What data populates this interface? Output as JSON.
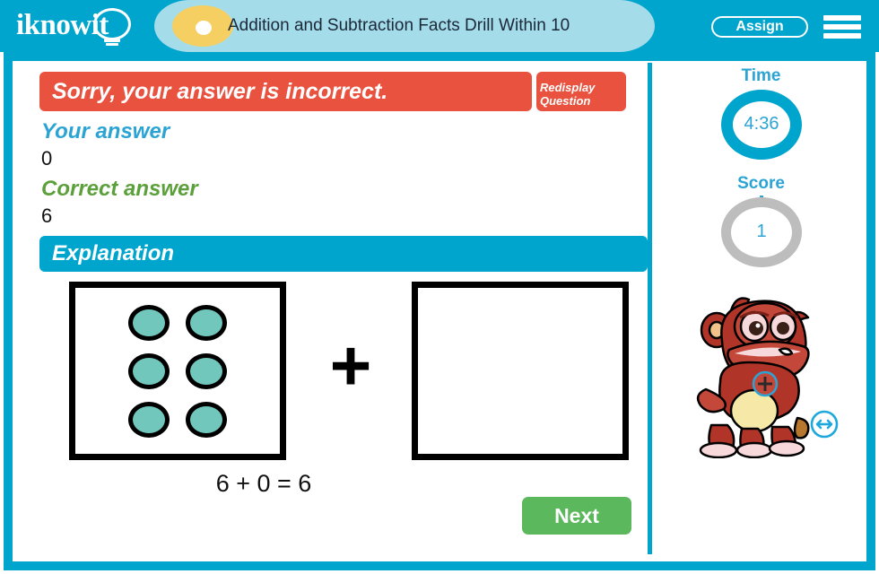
{
  "header": {
    "logo_text": "iknowit",
    "logo_icon": "lightbulb-icon",
    "title": "Addition and Subtraction Facts Drill Within 10",
    "assign_label": "Assign",
    "menu_icon": "hamburger-menu-icon",
    "bar_color": "#00A5CE",
    "title_band_color": "#A5DCEA",
    "title_dot_color": "#F6CF62"
  },
  "feedback": {
    "message": "Sorry, your answer is incorrect.",
    "redisplay_label": "Redisplay\nQuestion",
    "redisplay_line1": "Redisplay",
    "redisplay_line2": "Question",
    "banner_color": "#E8523F"
  },
  "answers": {
    "your_answer_label": "Your answer",
    "your_answer_value": "0",
    "your_answer_color": "#2BA4D4",
    "correct_answer_label": "Correct answer",
    "correct_answer_value": "6",
    "correct_answer_color": "#5CA03C"
  },
  "explanation": {
    "heading": "Explanation",
    "left_group_count": 6,
    "right_group_count": 0,
    "operator": "+",
    "equation": "6 + 0 = 6",
    "dot_color": "#72C7BC"
  },
  "next_button": {
    "label": "Next",
    "color": "#5CB85C"
  },
  "sidebar": {
    "time_label": "Time",
    "time_value": "4:36",
    "time_ring_color": "#00A5CE",
    "score_label": "Score",
    "score_value": "1",
    "score_ring_color": "#BDBDBD",
    "mascot_icon": "red-monster-mascot",
    "swap_icon": "left-right-arrow-icon"
  }
}
